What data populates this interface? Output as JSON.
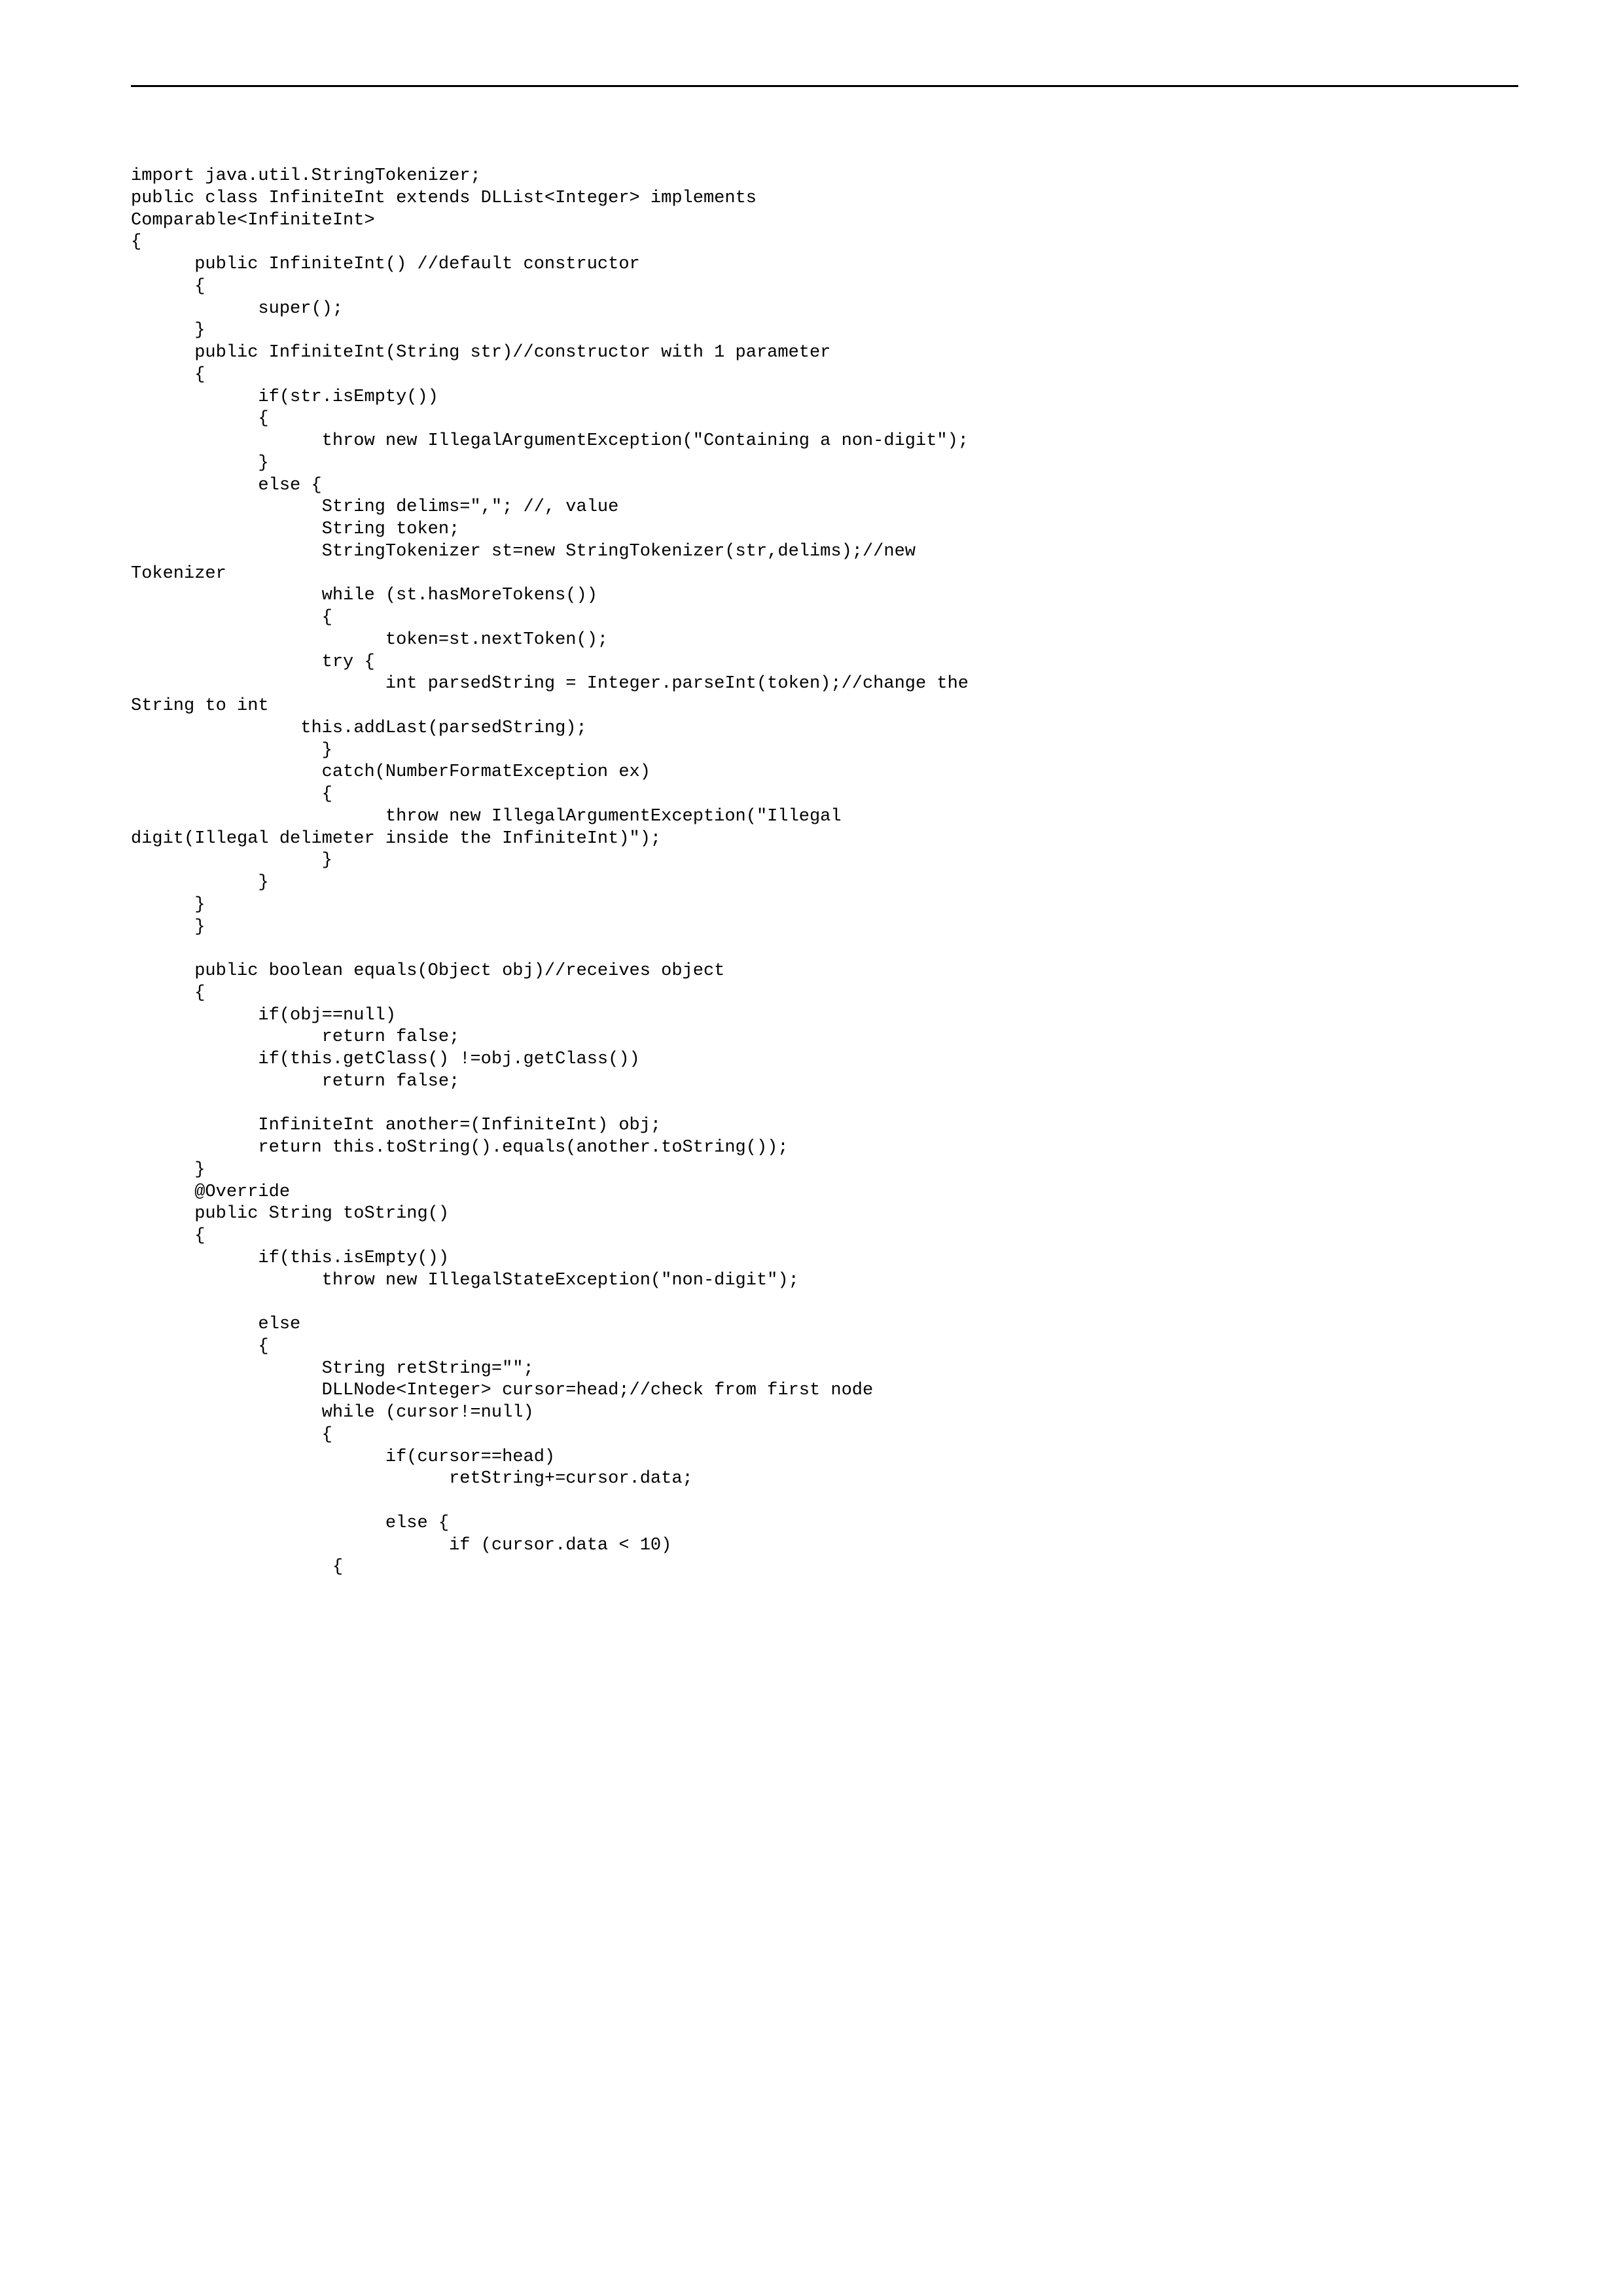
{
  "code": "import java.util.StringTokenizer;\npublic class InfiniteInt extends DLList<Integer> implements\nComparable<InfiniteInt>\n{\n      public InfiniteInt() //default constructor\n      {\n            super();\n      }\n      public InfiniteInt(String str)//constructor with 1 parameter\n      {\n            if(str.isEmpty())\n            {\n                  throw new IllegalArgumentException(\"Containing a non-digit\");\n            }\n            else {\n                  String delims=\",\"; //, value\n                  String token;\n                  StringTokenizer st=new StringTokenizer(str,delims);//new\nTokenizer\n                  while (st.hasMoreTokens())\n                  {\n                        token=st.nextToken();\n                  try {\n                        int parsedString = Integer.parseInt(token);//change the\nString to int\n                this.addLast(parsedString);\n                  }\n                  catch(NumberFormatException ex)\n                  {\n                        throw new IllegalArgumentException(\"Illegal\ndigit(Illegal delimeter inside the InfiniteInt)\");\n                  }\n            }\n      }\n      }\n\n      public boolean equals(Object obj)//receives object\n      {\n            if(obj==null)\n                  return false;\n            if(this.getClass() !=obj.getClass())\n                  return false;\n\n            InfiniteInt another=(InfiniteInt) obj;\n            return this.toString().equals(another.toString());\n      }\n      @Override\n      public String toString()\n      {\n            if(this.isEmpty())\n                  throw new IllegalStateException(\"non-digit\");\n\n            else\n            {\n                  String retString=\"\";\n                  DLLNode<Integer> cursor=head;//check from first node\n                  while (cursor!=null)\n                  {\n                        if(cursor==head)\n                              retString+=cursor.data;\n\n                        else {\n                              if (cursor.data < 10)\n                   {"
}
